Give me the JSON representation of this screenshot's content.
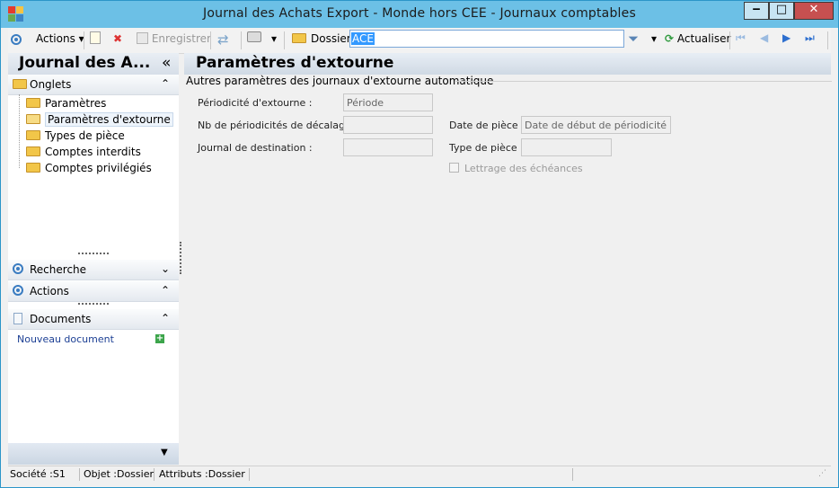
{
  "window": {
    "title": "Journal  des  Achats Export  -  Monde  hors CEE -  Journaux comptables",
    "minimize": "‒",
    "maximize": "□",
    "close": "✕"
  },
  "toolbar": {
    "actions_label": "Actions",
    "save_label": "Enregistrer",
    "dossier_label": "Dossier",
    "dossier_value": "ACE",
    "refresh_label": "Actualiser"
  },
  "left_panel": {
    "title": "Journal  des  A...",
    "collapse_glyph": "«",
    "onglets_label": "Onglets",
    "tabs": [
      {
        "label": "Paramètres"
      },
      {
        "label": "Paramètres d'extourne"
      },
      {
        "label": "Types de pièce"
      },
      {
        "label": "Comptes interdits"
      },
      {
        "label": "Comptes privilégiés"
      }
    ],
    "recherche_label": "Recherche",
    "actions_label": "Actions",
    "documents_label": "Documents",
    "new_document_label": "Nouveau document"
  },
  "main": {
    "title": "Paramètres d'extourne",
    "group_title": "Autres paramètres des journaux d'extourne automatique",
    "fields": {
      "periodicite_label": "Périodicité d'extourne :",
      "periodicite_value": "Période",
      "nb_decalage_label": "Nb de périodicités de décalage :",
      "nb_decalage_value": "",
      "journal_dest_label": "Journal de destination :",
      "journal_dest_value": "",
      "date_piece_label": "Date de pièce :",
      "date_piece_value": "Date de début de périodicité",
      "type_piece_label": "Type de pièce :",
      "type_piece_value": "",
      "lettrage_label": "Lettrage des échéances"
    }
  },
  "statusbar": {
    "societe": "Société :S1",
    "objet": "Objet :Dossier",
    "attributs": "Attributs :Dossier"
  },
  "colors": {
    "titlebar": "#6cc0e6",
    "accent_blue": "#3a7cc1",
    "folder": "#f2c649",
    "selection": "#3399ff"
  }
}
